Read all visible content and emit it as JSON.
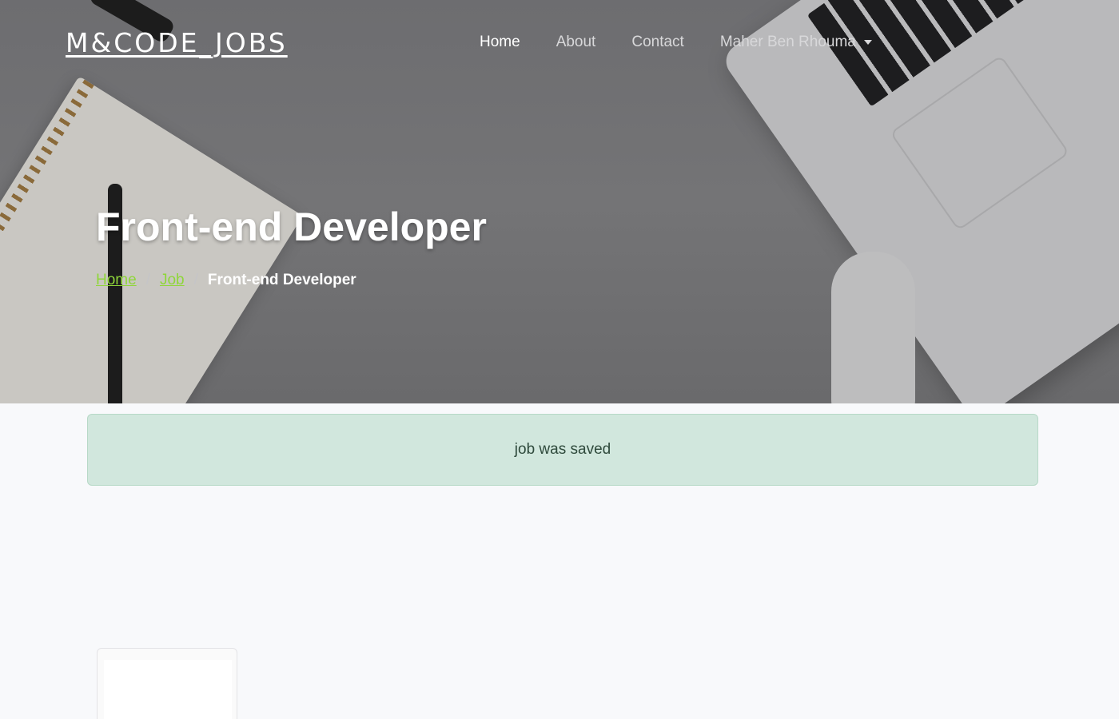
{
  "nav": {
    "brand": "M&CODE_JOBS",
    "links": [
      {
        "label": "Home",
        "active": true
      },
      {
        "label": "About",
        "active": false
      },
      {
        "label": "Contact",
        "active": false
      }
    ],
    "user_menu": "Maher Ben Rhouma"
  },
  "hero": {
    "title": "Front-end Developer",
    "breadcrumb": {
      "home": "Home",
      "job": "Job",
      "current": "Front-end Developer"
    }
  },
  "alert": {
    "message": "job was saved",
    "color": "#d1e7dd"
  },
  "colors": {
    "accent_link": "#8fd63a",
    "page_bg": "#f8f9fb"
  }
}
